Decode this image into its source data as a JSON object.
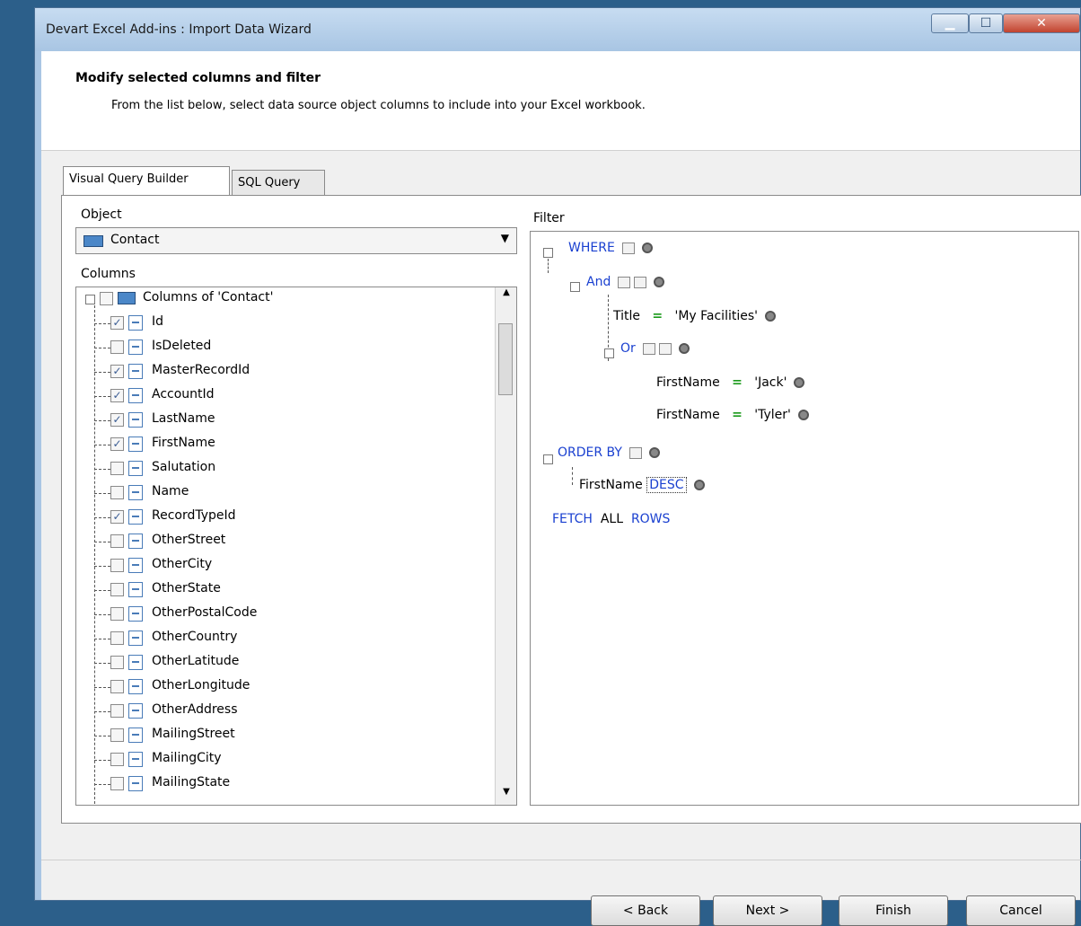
{
  "window": {
    "title": "Devart Excel Add-ins : Import Data Wizard"
  },
  "header": {
    "title": "Modify selected columns and filter",
    "description": "From the list below, select data source object columns to include into your Excel workbook."
  },
  "tabs": [
    {
      "label": "Visual Query Builder",
      "active": true
    },
    {
      "label": "SQL Query",
      "active": false
    }
  ],
  "object": {
    "label": "Object",
    "value": "Contact"
  },
  "columns": {
    "label": "Columns",
    "root": "Columns of 'Contact'",
    "items": [
      {
        "name": "Id",
        "checked": true
      },
      {
        "name": "IsDeleted",
        "checked": false
      },
      {
        "name": "MasterRecordId",
        "checked": true
      },
      {
        "name": "AccountId",
        "checked": true
      },
      {
        "name": "LastName",
        "checked": true
      },
      {
        "name": "FirstName",
        "checked": true
      },
      {
        "name": "Salutation",
        "checked": false
      },
      {
        "name": "Name",
        "checked": false
      },
      {
        "name": "RecordTypeId",
        "checked": true
      },
      {
        "name": "OtherStreet",
        "checked": false
      },
      {
        "name": "OtherCity",
        "checked": false
      },
      {
        "name": "OtherState",
        "checked": false
      },
      {
        "name": "OtherPostalCode",
        "checked": false
      },
      {
        "name": "OtherCountry",
        "checked": false
      },
      {
        "name": "OtherLatitude",
        "checked": false
      },
      {
        "name": "OtherLongitude",
        "checked": false
      },
      {
        "name": "OtherAddress",
        "checked": false
      },
      {
        "name": "MailingStreet",
        "checked": false
      },
      {
        "name": "MailingCity",
        "checked": false
      },
      {
        "name": "MailingState",
        "checked": false
      }
    ]
  },
  "filter": {
    "label": "Filter",
    "where": "WHERE",
    "and": "And",
    "title_field": "Title",
    "title_value": "'My Facilities'",
    "or": "Or",
    "firstname_1": "FirstName",
    "value_1": "'Jack'",
    "firstname_2": "FirstName",
    "value_2": "'Tyler'",
    "order_by": "ORDER BY",
    "order_field": "FirstName",
    "order_dir": "DESC",
    "fetch": "FETCH",
    "all": "ALL",
    "rows": "ROWS",
    "equals": "="
  },
  "buttons": {
    "back": "< Back",
    "next": "Next >",
    "finish": "Finish",
    "cancel": "Cancel"
  },
  "icons": {
    "minimize": "minimize-icon",
    "maximize": "maximize-icon",
    "close": "close-icon"
  }
}
